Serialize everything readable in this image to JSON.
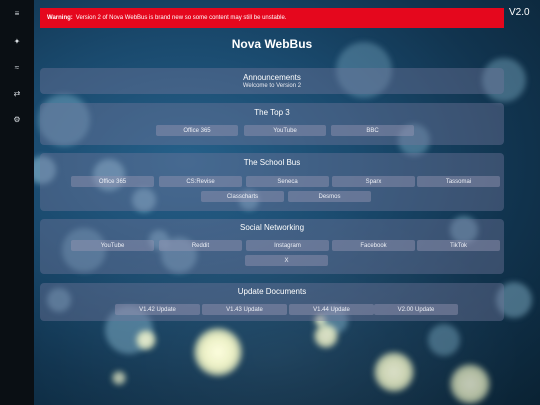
{
  "sidebar": {
    "items": [
      {
        "icon": "≡",
        "name": "menu-icon"
      },
      {
        "icon": "✦",
        "name": "bus-icon"
      },
      {
        "icon": "≈",
        "name": "wave-icon"
      },
      {
        "icon": "⇄",
        "name": "swap-icon"
      },
      {
        "icon": "⚙",
        "name": "gear-icon"
      }
    ]
  },
  "banner": {
    "strong": "Warning:",
    "text": "Version 2 of Nova WebBus is brand new so some content may still be unstable."
  },
  "version": "V2.0",
  "title": "Nova WebBus",
  "announcements": {
    "title": "Announcements",
    "text": "Welcome to Version 2"
  },
  "top3": {
    "title": "The Top 3",
    "items": [
      "Office 365",
      "YouTube",
      "BBC"
    ]
  },
  "school_bus": {
    "title": "The School Bus",
    "items": [
      "Office 365",
      "CS:Revise",
      "Seneca",
      "Sparx",
      "Tassomai",
      "Classcharts",
      "Desmos"
    ]
  },
  "social": {
    "title": "Social Networking",
    "items": [
      "YouTube",
      "Reddit",
      "Instagram",
      "Facebook",
      "TikTok",
      "X"
    ]
  },
  "updates": {
    "title": "Update Documents",
    "items": [
      "V1.42 Update",
      "V1.43 Update",
      "V1.44 Update",
      "V2.00 Update"
    ]
  },
  "colors": {
    "banner": "#e5071d",
    "sidebar": "#0a0f14",
    "panel": "#73789b"
  }
}
